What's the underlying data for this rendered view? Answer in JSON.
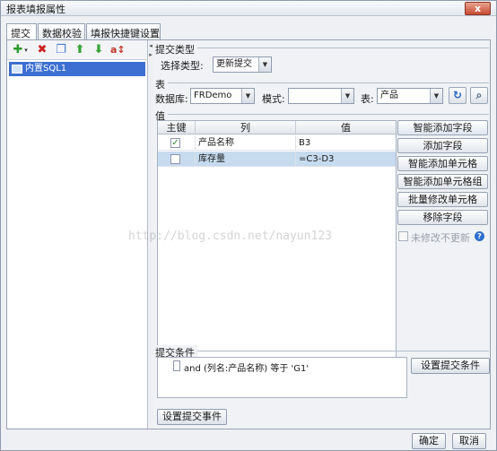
{
  "window": {
    "title": "报表填报属性",
    "close_label": "x"
  },
  "tabs": [
    {
      "label": "提交"
    },
    {
      "label": "数据校验"
    },
    {
      "label": "填报快捷键设置"
    }
  ],
  "toolbar": {
    "icons": [
      "add-icon",
      "delete-icon",
      "copy-icon",
      "move-up-icon",
      "move-down-icon",
      "sort-icon"
    ]
  },
  "tree": {
    "items": [
      {
        "label": "内置SQL1"
      }
    ]
  },
  "submit_type": {
    "group_label": "提交类型",
    "label": "选择类型:",
    "value": "更新提交"
  },
  "table_group": {
    "group_label": "表",
    "db_label": "数据库:",
    "db_value": "FRDemo",
    "mode_label": "模式:",
    "mode_value": "",
    "table_label": "表:",
    "table_value": "产品"
  },
  "values_group": {
    "group_label": "值",
    "columns": [
      "主键",
      "列",
      "值"
    ],
    "rows": [
      {
        "key_checked": "✓",
        "column": "产品名称",
        "value": "B3"
      },
      {
        "key_checked": "",
        "column": "库存量",
        "value": "=C3-D3"
      }
    ],
    "buttons": [
      "智能添加字段",
      "添加字段",
      "智能添加单元格",
      "智能添加单元格组",
      "批量修改单元格",
      "移除字段"
    ],
    "unmodified_label": "未修改不更新",
    "help_glyph": "?"
  },
  "condition": {
    "group_label": "提交条件",
    "text": "and (列名:产品名称) 等于 'G1'",
    "button": "设置提交条件"
  },
  "event_button": "设置提交事件",
  "footer": {
    "ok": "确定",
    "cancel": "取消"
  },
  "watermark": "http://blog.csdn.net/nayun123"
}
